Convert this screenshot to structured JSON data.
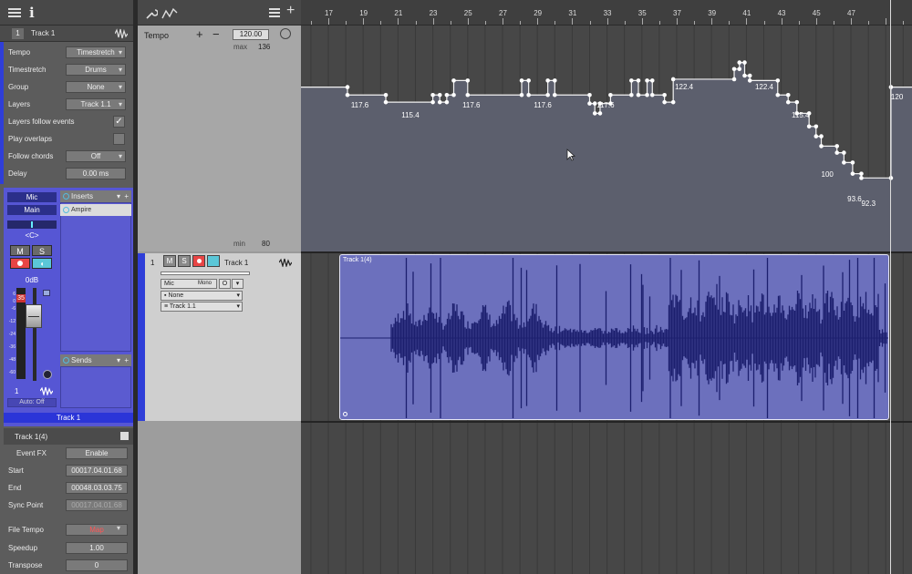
{
  "inspector": {
    "track_number": "1",
    "track_name": "Track 1",
    "properties": [
      {
        "label": "Tempo",
        "value": "Timestretch",
        "type": "dropdown"
      },
      {
        "label": "Timestretch",
        "value": "Drums",
        "type": "dropdown"
      },
      {
        "label": "Group",
        "value": "None",
        "type": "dropdown"
      },
      {
        "label": "Layers",
        "value": "Track 1.1",
        "type": "dropdown"
      },
      {
        "label": "Layers follow events",
        "value": "✓",
        "type": "checkbox"
      },
      {
        "label": "Play overlaps",
        "value": "",
        "type": "checkbox"
      },
      {
        "label": "Follow chords",
        "value": "Off",
        "type": "dropdown"
      },
      {
        "label": "Delay",
        "value": "0.00 ms",
        "type": "field"
      }
    ]
  },
  "mixer": {
    "input": "Mic",
    "output": "Main",
    "pan": "<C>",
    "mute": "M",
    "solo": "S",
    "gain": "0dB",
    "meter_peak": "35",
    "scale": [
      "6",
      "0",
      "-6",
      "-12",
      "-24",
      "-36",
      "-48",
      "-60"
    ],
    "channel_number": "1",
    "automation": "Auto: Off",
    "channel_name": "Track 1",
    "inserts_label": "Inserts",
    "insert_item": "Ampire",
    "sends_label": "Sends"
  },
  "event_inspector": {
    "event_name": "Track 1(4)",
    "event_fx_label": "Event FX",
    "enable_label": "Enable",
    "fields": [
      {
        "label": "Start",
        "value": "00017.04.01.68",
        "style": "normal"
      },
      {
        "label": "End",
        "value": "00048.03.03.75",
        "style": "normal"
      },
      {
        "label": "Sync Point",
        "value": "00017.04.01.68",
        "style": "dim"
      },
      {
        "label": "File Tempo",
        "value": "Map",
        "style": "red"
      },
      {
        "label": "Speedup",
        "value": "1.00",
        "style": "normal"
      },
      {
        "label": "Transpose",
        "value": "0",
        "style": "normal"
      }
    ]
  },
  "tempo_track": {
    "title": "Tempo",
    "plus": "+",
    "minus": "−",
    "value": "120.00",
    "max_label": "max",
    "max_value": "136",
    "min_label": "min",
    "min_value": "80",
    "point_labels": [
      {
        "bar": 18.3,
        "text": "117.6"
      },
      {
        "bar": 21.2,
        "text": "115.4"
      },
      {
        "bar": 24.7,
        "text": "117.6"
      },
      {
        "bar": 28.8,
        "text": "117.6"
      },
      {
        "bar": 32.4,
        "text": "117.6"
      },
      {
        "bar": 36.9,
        "text": "122.4"
      },
      {
        "bar": 41.5,
        "text": "122.4"
      },
      {
        "bar": 43.6,
        "text": "115.4"
      },
      {
        "bar": 45.3,
        "text": "100"
      },
      {
        "bar": 46.8,
        "text": "93.6"
      },
      {
        "bar": 47.6,
        "text": "92.3"
      },
      {
        "bar": 49.3,
        "text": "120"
      }
    ]
  },
  "audio_track": {
    "number": "1",
    "name": "Track 1",
    "mute": "M",
    "solo": "S",
    "input": "Mic",
    "channel_mode": "Mono",
    "output": "None",
    "layer": "Track 1.1",
    "event_name": "Track 1(4)"
  },
  "ruler": {
    "labels": [
      "17",
      "19",
      "21",
      "23",
      "25",
      "27",
      "29",
      "31",
      "33",
      "35",
      "37",
      "39",
      "41",
      "43",
      "45",
      "47"
    ]
  },
  "colors": {
    "track_blue": "#2f3ed8",
    "mixer_bg": "#5656d4",
    "event_fill": "#6c70bd",
    "waveform": "#1c1f6e",
    "record_red": "#e84545",
    "monitor_cyan": "#5bc7d8"
  }
}
